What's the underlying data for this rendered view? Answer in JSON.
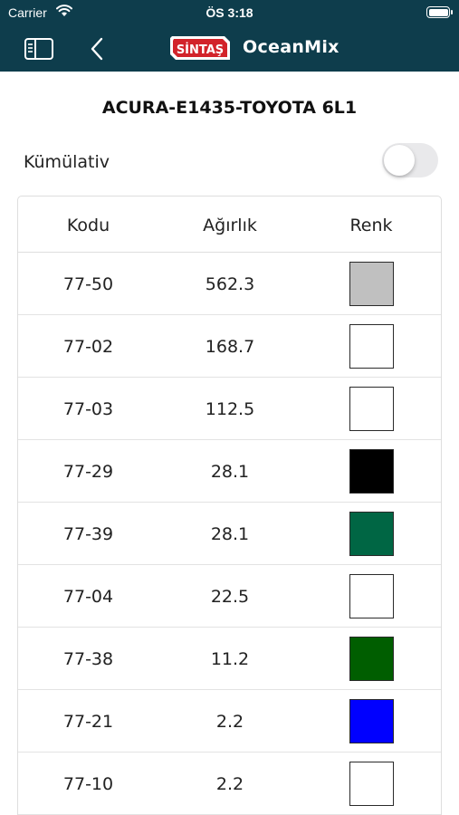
{
  "status_bar": {
    "carrier": "Carrier",
    "time": "ÖS 3:18"
  },
  "nav": {
    "sidebar_icon": "sidebar-icon",
    "back_icon": "chevron-left-icon",
    "brand_logo": "SİNTAŞ",
    "brand_name": "OceanMix",
    "bar_color": "#0e3d4c"
  },
  "page": {
    "title": "ACURA-E1435-TOYOTA 6L1",
    "cumulative_label": "Kümülativ",
    "cumulative_on": false
  },
  "table": {
    "headers": [
      "Kodu",
      "Ağırlık",
      "Renk"
    ],
    "rows": [
      {
        "code": "77-50",
        "weight": "562.3",
        "color": "#c0c0c0"
      },
      {
        "code": "77-02",
        "weight": "168.7",
        "color": "#ffffff"
      },
      {
        "code": "77-03",
        "weight": "112.5",
        "color": "#ffffff"
      },
      {
        "code": "77-29",
        "weight": "28.1",
        "color": "#000000"
      },
      {
        "code": "77-39",
        "weight": "28.1",
        "color": "#006644"
      },
      {
        "code": "77-04",
        "weight": "22.5",
        "color": "#ffffff"
      },
      {
        "code": "77-38",
        "weight": "11.2",
        "color": "#005e00"
      },
      {
        "code": "77-21",
        "weight": "2.2",
        "color": "#0000ff"
      },
      {
        "code": "77-10",
        "weight": "2.2",
        "color": "#ffffff"
      }
    ]
  }
}
